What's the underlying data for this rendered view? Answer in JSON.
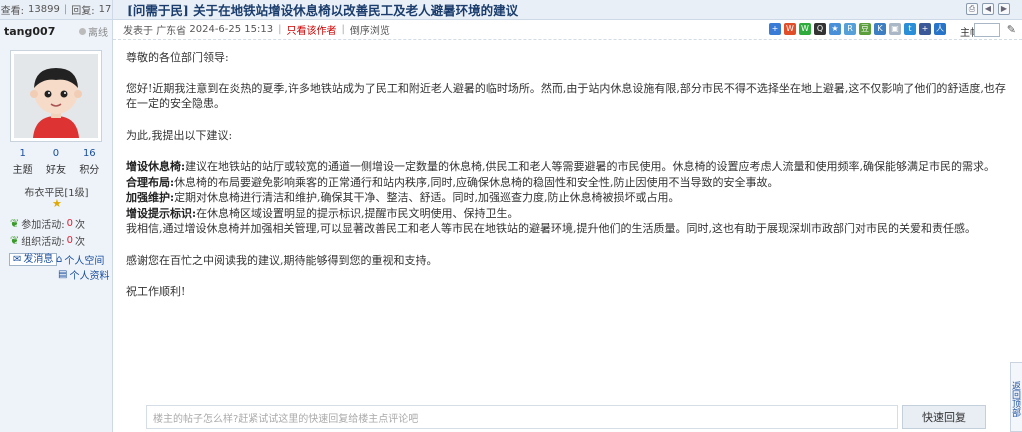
{
  "thread": {
    "views_label": "查看:",
    "views": "13899",
    "replies_label": "回复:",
    "replies": "17",
    "title": "[问需于民] 关于在地铁站增设休息椅以改善民工及老人避暑环境的建议"
  },
  "author": {
    "username": "tang007",
    "status": "离线",
    "stats": [
      {
        "value": "1",
        "label": "主题"
      },
      {
        "value": "0",
        "label": "好友"
      },
      {
        "value": "16",
        "label": "积分"
      }
    ],
    "rank": "布衣平民[1级]",
    "activity_joined_label": "参加活动:",
    "activity_joined": "0",
    "activity_org_label": "组织活动:",
    "activity_org": "0",
    "count_unit": "次",
    "send_message": "发消息",
    "personal_space": "个人空间",
    "personal_profile": "个人资料"
  },
  "post_info": {
    "posted_prefix": "发表于",
    "location": "广东省",
    "datetime": "2024-6-25 15:13",
    "author_only": "只看该作者",
    "reverse_view": "倒序浏览",
    "floor_label": "主帖"
  },
  "content": {
    "greeting": "尊敬的各位部门领导:",
    "para1": "您好!近期我注意到在炎热的夏季,许多地铁站成为了民工和附近老人避暑的临时场所。然而,由于站内休息设施有限,部分市民不得不选择坐在地上避暑,这不仅影响了他们的舒适度,也存在一定的安全隐患。",
    "para2": "为此,我提出以下建议:",
    "s1_title": "增设休息椅:",
    "s1_text": "建议在地铁站的站厅或较宽的通道一侧增设一定数量的休息椅,供民工和老人等需要避暑的市民使用。休息椅的设置应考虑人流量和使用频率,确保能够满足市民的需求。",
    "s2_title": "合理布局:",
    "s2_text": "休息椅的布局要避免影响乘客的正常通行和站内秩序,同时,应确保休息椅的稳固性和安全性,防止因使用不当导致的安全事故。",
    "s3_title": "加强维护:",
    "s3_text": "定期对休息椅进行清洁和维护,确保其干净、整洁、舒适。同时,加强巡查力度,防止休息椅被损坏或占用。",
    "s4_title": "增设提示标识:",
    "s4_text": "在休息椅区域设置明显的提示标识,提醒市民文明使用、保持卫生。",
    "para3": "我相信,通过增设休息椅并加强相关管理,可以显著改善民工和老人等市民在地铁站的避暑环境,提升他们的生活质量。同时,这也有助于展现深圳市政部门对市民的关爱和责任感。",
    "para4": "感谢您在百忙之中阅读我的建议,期待能够得到您的重视和支持。",
    "closing": "祝工作顺利!"
  },
  "reply": {
    "placeholder": "楼主的帖子怎么样?赶紧试试这里的快速回复给楼主点评论吧",
    "button": "快速回复"
  },
  "side_float": "返回顶部",
  "colors": {
    "header_bg": "#e9eff6",
    "title": "#1a3d6d",
    "link": "#1a4fa0",
    "warn": "#c00000"
  }
}
